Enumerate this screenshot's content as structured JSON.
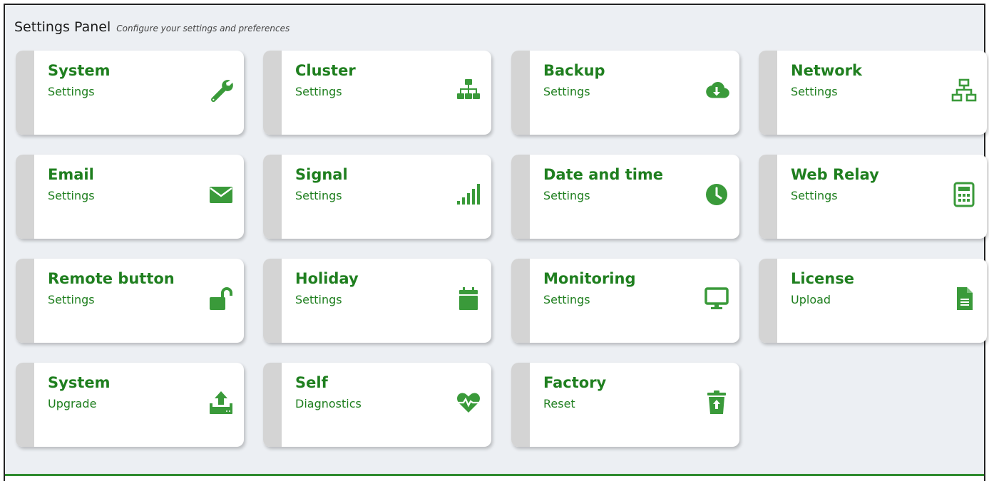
{
  "header": {
    "title": "Settings Panel",
    "subtitle": "Configure your settings and preferences"
  },
  "colors": {
    "accent": "#2e8b2e",
    "text": "#1f7f1f",
    "stripe": "#d4d4d4",
    "background": "#eceff3"
  },
  "cards": [
    {
      "title": "System",
      "subtitle": "Settings",
      "icon": "wrench-icon"
    },
    {
      "title": "Cluster",
      "subtitle": "Settings",
      "icon": "sitemap-icon"
    },
    {
      "title": "Backup",
      "subtitle": "Settings",
      "icon": "cloud-download-icon"
    },
    {
      "title": "Network",
      "subtitle": "Settings",
      "icon": "network-icon"
    },
    {
      "title": "Email",
      "subtitle": "Settings",
      "icon": "envelope-icon"
    },
    {
      "title": "Signal",
      "subtitle": "Settings",
      "icon": "signal-icon"
    },
    {
      "title": "Date and time",
      "subtitle": "Settings",
      "icon": "clock-icon"
    },
    {
      "title": "Web Relay",
      "subtitle": "Settings",
      "icon": "calculator-icon"
    },
    {
      "title": "Remote button",
      "subtitle": "Settings",
      "icon": "unlock-icon"
    },
    {
      "title": "Holiday",
      "subtitle": "Settings",
      "icon": "calendar-icon"
    },
    {
      "title": "Monitoring",
      "subtitle": "Settings",
      "icon": "monitor-icon"
    },
    {
      "title": "License",
      "subtitle": "Upload",
      "icon": "document-icon"
    },
    {
      "title": "System",
      "subtitle": "Upgrade",
      "icon": "upload-icon"
    },
    {
      "title": "Self",
      "subtitle": "Diagnostics",
      "icon": "heartbeat-icon"
    },
    {
      "title": "Factory",
      "subtitle": "Reset",
      "icon": "trash-restore-icon"
    }
  ]
}
